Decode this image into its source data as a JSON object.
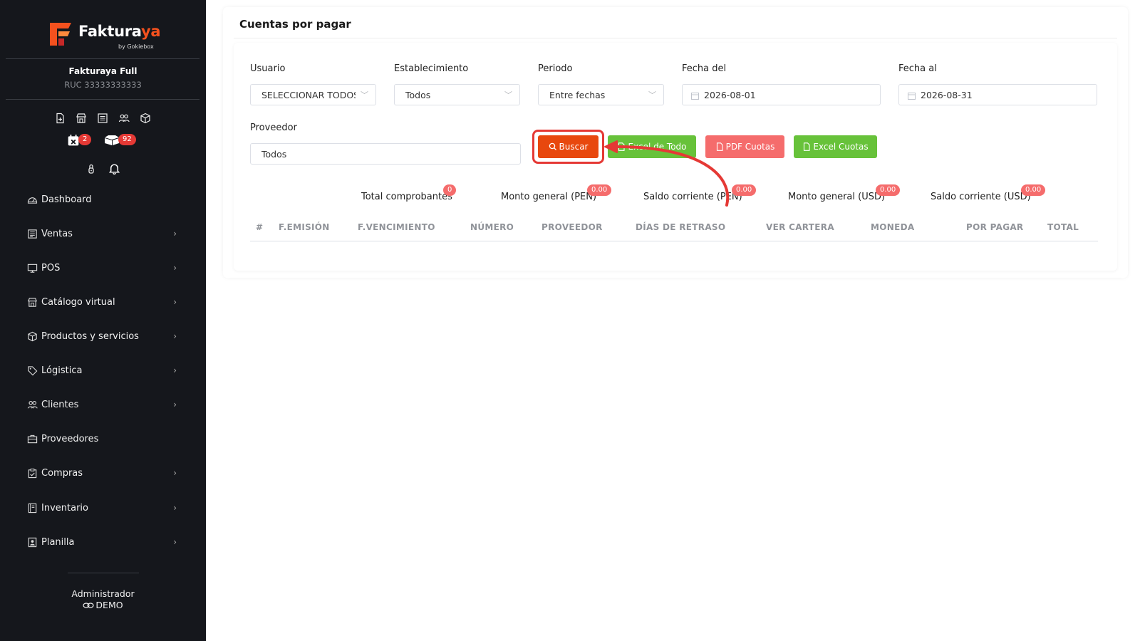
{
  "brand": {
    "name_main": "Faktura",
    "name_accent": "ya",
    "byline": "by Gokiebox"
  },
  "company": {
    "name": "Fakturaya Full",
    "ruc": "RUC 33333333333"
  },
  "sidebar": {
    "badges": {
      "calendar": "2",
      "boxes": "92"
    },
    "items": [
      {
        "label": "Dashboard",
        "icon": "dashboard-icon"
      },
      {
        "label": "Ventas",
        "icon": "sales-icon"
      },
      {
        "label": "POS",
        "icon": "monitor-icon"
      },
      {
        "label": "Catálogo virtual",
        "icon": "store-icon"
      },
      {
        "label": "Productos y servicios",
        "icon": "box-icon"
      },
      {
        "label": "Lógistica",
        "icon": "tag-icon"
      },
      {
        "label": "Clientes",
        "icon": "users-icon"
      },
      {
        "label": "Proveedores",
        "icon": "briefcase-icon"
      },
      {
        "label": "Compras",
        "icon": "clipboard-check-icon"
      },
      {
        "label": "Inventario",
        "icon": "book-icon"
      },
      {
        "label": "Planilla",
        "icon": "id-card-icon"
      }
    ],
    "user_role": "Administrador",
    "user_name": "DEMO"
  },
  "page": {
    "title": "Cuentas por pagar"
  },
  "filters": {
    "usuario": {
      "label": "Usuario",
      "value": "SELECCIONAR TODOS"
    },
    "establecimiento": {
      "label": "Establecimiento",
      "value": "Todos"
    },
    "periodo": {
      "label": "Periodo",
      "value": "Entre fechas"
    },
    "fecha_del": {
      "label": "Fecha del",
      "value": "2026-08-01"
    },
    "fecha_al": {
      "label": "Fecha al",
      "value": "2026-08-31"
    },
    "proveedor": {
      "label": "Proveedor",
      "value": "Todos"
    }
  },
  "buttons": {
    "buscar": "Buscar",
    "excel_todo": "Excel de Todo",
    "pdf_cuotas": "PDF Cuotas",
    "excel_cuotas": "Excel Cuotas"
  },
  "summary": [
    {
      "label": "Total comprobantes",
      "value": "0"
    },
    {
      "label": "Monto general (PEN)",
      "value": "0.00"
    },
    {
      "label": "Saldo corriente (PEN)",
      "value": "0.00"
    },
    {
      "label": "Monto general (USD)",
      "value": "0.00"
    },
    {
      "label": "Saldo corriente (USD)",
      "value": "0.00"
    }
  ],
  "table": {
    "columns": [
      "#",
      "F.EMISIÓN",
      "F.VENCIMIENTO",
      "NÚMERO",
      "PROVEEDOR",
      "DÍAS DE RETRASO",
      "VER CARTERA",
      "MONEDA",
      "POR PAGAR",
      "TOTAL"
    ],
    "rows": []
  },
  "colors": {
    "sidebar_bg": "#15171c",
    "accent": "#e8480e",
    "success": "#67c23a",
    "danger": "#f56c6c",
    "highlight": "#e53935"
  }
}
